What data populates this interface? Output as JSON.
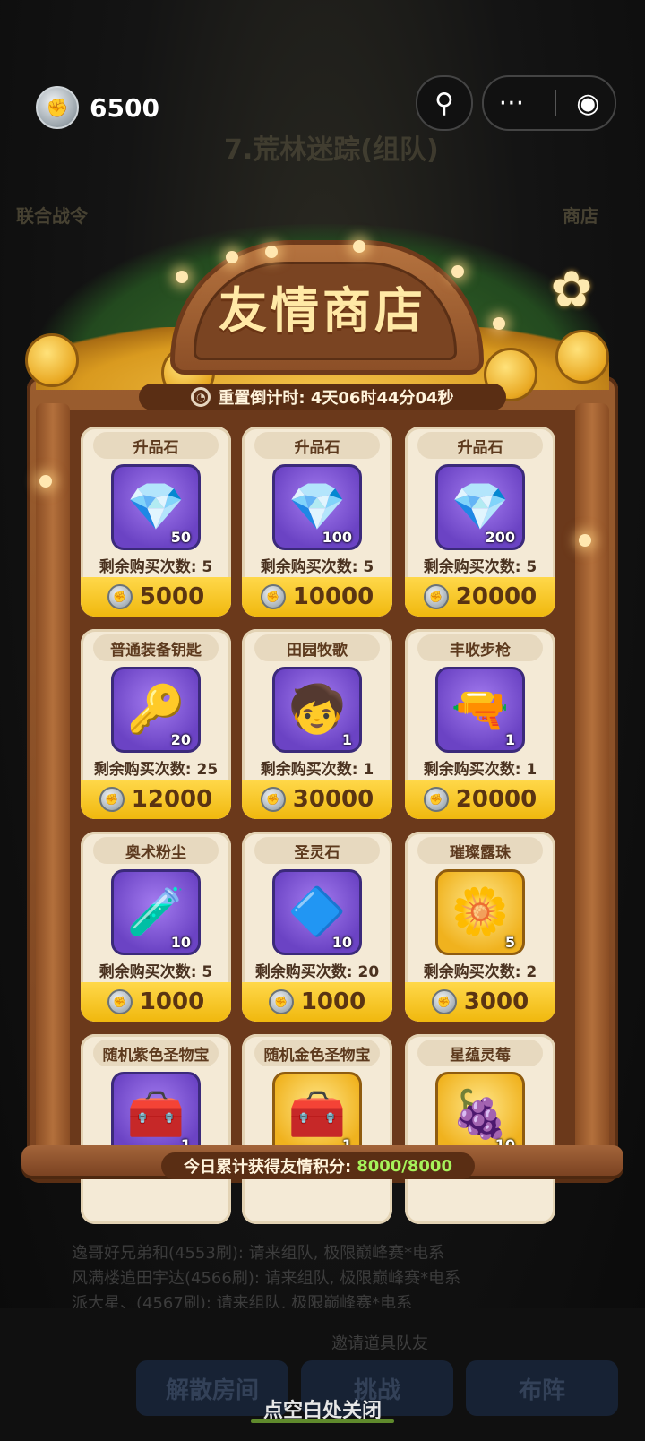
{
  "top_bar": {
    "currency_value": "6500",
    "currency_icon": "friendship-coin-icon",
    "profile_icon": "person-pin-icon",
    "more_icon": "more-dots-icon",
    "record_icon": "target-circle-icon"
  },
  "background": {
    "stage_title": "7.荒林迷踪(组队)",
    "left_label": "联合战令",
    "right_label": "商店",
    "chat_lines": [
      "逸哥好兄弟和(4553刷): 请来组队, 极限巅峰赛*电系",
      "风满楼追田宇达(4566刷): 请来组队, 极限巅峰赛*电系",
      "派大星、(4567刷): 请来组队, 极限巅峰赛*电系"
    ],
    "invite_text": "邀请道具队友",
    "buttons": [
      "解散房间",
      "挑战",
      "布阵"
    ]
  },
  "shop": {
    "title": "友情商店",
    "timer_label": "重置倒计时: 4天06时44分04秒",
    "footer_label": "今日累计获得友情积分:",
    "footer_value": "8000/8000",
    "items": [
      {
        "name": "升品石",
        "count": "50",
        "remain": "剩余购买次数: 5",
        "price": "5000",
        "glyph": "💎",
        "icon": "upgrade-stone-icon",
        "box": "purple"
      },
      {
        "name": "升品石",
        "count": "100",
        "remain": "剩余购买次数: 5",
        "price": "10000",
        "glyph": "💎",
        "icon": "upgrade-stone-icon",
        "box": "purple"
      },
      {
        "name": "升品石",
        "count": "200",
        "remain": "剩余购买次数: 5",
        "price": "20000",
        "glyph": "💎",
        "icon": "upgrade-stone-icon",
        "box": "purple"
      },
      {
        "name": "普通装备钥匙",
        "count": "20",
        "remain": "剩余购买次数: 25",
        "price": "12000",
        "glyph": "🔑",
        "icon": "equipment-key-icon",
        "box": "purple"
      },
      {
        "name": "田园牧歌",
        "count": "1",
        "remain": "剩余购买次数: 1",
        "price": "30000",
        "glyph": "🧒",
        "icon": "character-skin-icon",
        "box": "purple"
      },
      {
        "name": "丰收步枪",
        "count": "1",
        "remain": "剩余购买次数: 1",
        "price": "20000",
        "glyph": "🔫",
        "icon": "harvest-rifle-icon",
        "box": "purple"
      },
      {
        "name": "奥术粉尘",
        "count": "10",
        "remain": "剩余购买次数: 5",
        "price": "1000",
        "glyph": "🧪",
        "icon": "arcane-dust-potion-icon",
        "box": "purple"
      },
      {
        "name": "圣灵石",
        "count": "10",
        "remain": "剩余购买次数: 20",
        "price": "1000",
        "glyph": "🔷",
        "icon": "spirit-stone-icon",
        "box": "purple"
      },
      {
        "name": "璀璨露珠",
        "count": "5",
        "remain": "剩余购买次数: 2",
        "price": "3000",
        "glyph": "🌼",
        "icon": "dewdrop-flower-icon",
        "box": "gold"
      },
      {
        "name": "随机紫色圣物宝",
        "count": "1",
        "remain": "",
        "price": "",
        "glyph": "🧰",
        "icon": "purple-relic-chest-icon",
        "box": "purple"
      },
      {
        "name": "随机金色圣物宝",
        "count": "1",
        "remain": "",
        "price": "",
        "glyph": "🧰",
        "icon": "gold-relic-chest-icon",
        "box": "gold"
      },
      {
        "name": "星蕴灵莓",
        "count": "10",
        "remain": "",
        "price": "",
        "glyph": "🍇",
        "icon": "star-berry-icon",
        "box": "gold"
      }
    ]
  },
  "close_hint": "点空白处关闭"
}
